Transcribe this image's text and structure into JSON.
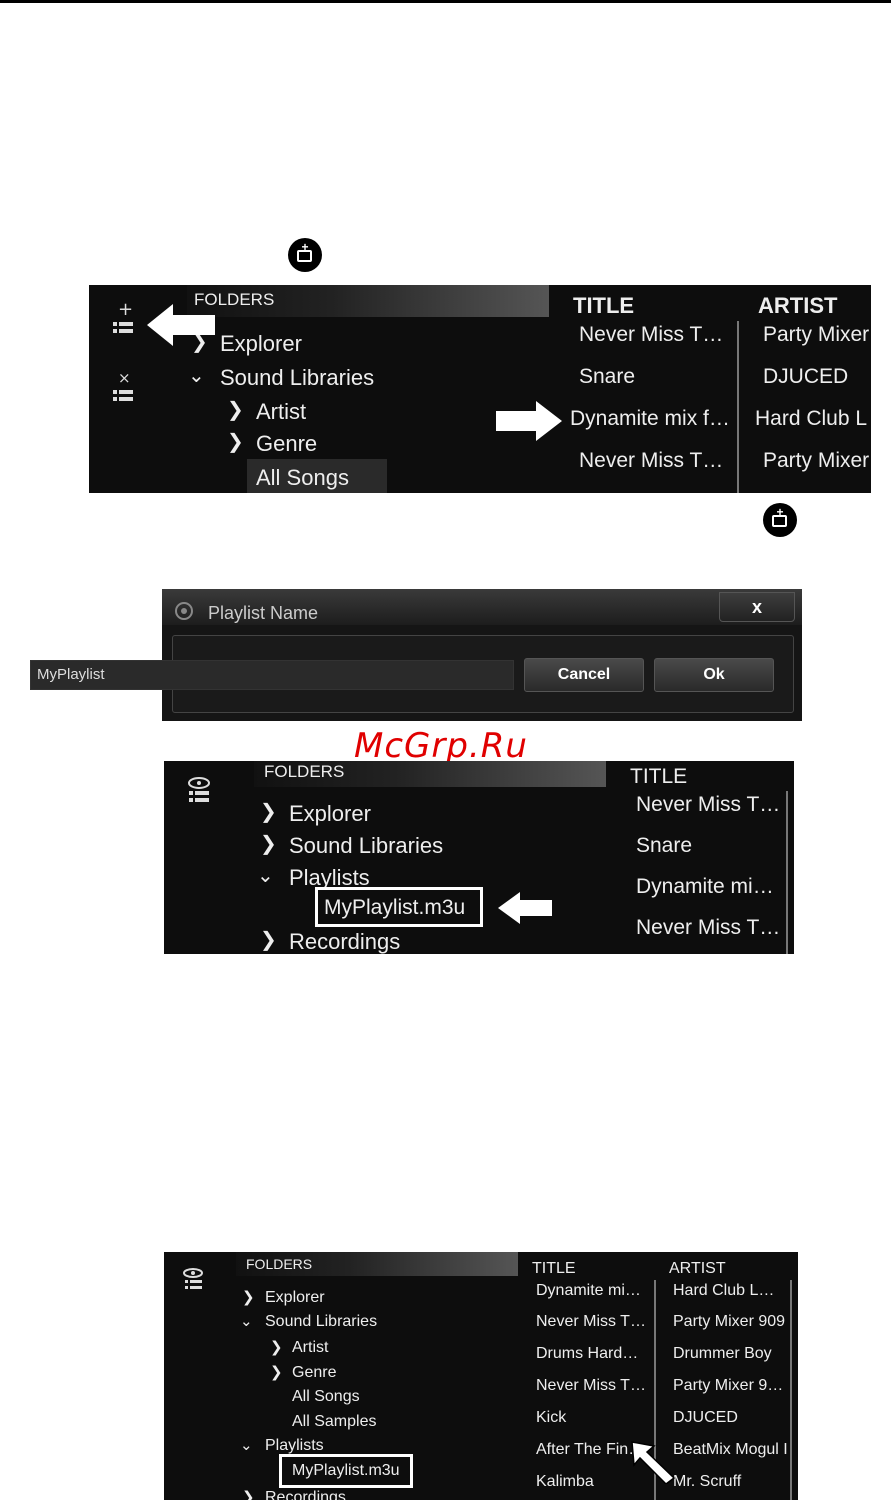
{
  "add_playlist_icon": "add-list-icon",
  "panel1": {
    "folders_header": "FOLDERS",
    "add_icon": "add-list-icon",
    "remove_icon": "remove-list-icon",
    "tree": {
      "explorer": "Explorer",
      "sound_libraries": "Sound Libraries",
      "artist": "Artist",
      "genre": "Genre",
      "all_songs": "All Songs"
    },
    "columns": {
      "title": "TITLE",
      "artist": "ARTIST"
    },
    "rows": [
      {
        "title": "Never Miss T…",
        "artist": "Party Mixer"
      },
      {
        "title": "Snare",
        "artist": "DJUCED"
      },
      {
        "title": "Dynamite mix f…",
        "artist": "Hard Club L"
      },
      {
        "title": "Never Miss T…",
        "artist": "Party Mixer"
      }
    ]
  },
  "dialog": {
    "title": "Playlist Name",
    "close": "x",
    "input_value": "MyPlaylist",
    "cancel": "Cancel",
    "ok": "Ok"
  },
  "watermark": "McGrp.Ru",
  "panel2": {
    "folders_header": "FOLDERS",
    "tree": {
      "explorer": "Explorer",
      "sound_libraries": "Sound Libraries",
      "playlists": "Playlists",
      "playlist_item": "MyPlaylist.m3u",
      "recordings": "Recordings"
    },
    "columns": {
      "title": "TITLE"
    },
    "rows": [
      "Never Miss T…",
      "Snare",
      "Dynamite mi…",
      "Never Miss T…"
    ]
  },
  "panel3": {
    "folders_header": "FOLDERS",
    "tree": {
      "explorer": "Explorer",
      "sound_libraries": "Sound Libraries",
      "artist": "Artist",
      "genre": "Genre",
      "all_songs": "All Songs",
      "all_samples": "All Samples",
      "playlists": "Playlists",
      "playlist_item": "MyPlaylist.m3u",
      "recordings": "Recordings"
    },
    "columns": {
      "title": "TITLE",
      "artist": "ARTIST"
    },
    "rows": [
      {
        "title": "Dynamite mi…",
        "artist": "Hard Club L…"
      },
      {
        "title": "Never Miss T…",
        "artist": "Party Mixer 909"
      },
      {
        "title": "Drums Hard…",
        "artist": "Drummer Boy"
      },
      {
        "title": "Never Miss T…",
        "artist": "Party Mixer 9…"
      },
      {
        "title": "Kick",
        "artist": "DJUCED"
      },
      {
        "title": "After The Fin…",
        "artist": "BeatMix Mogul I"
      },
      {
        "title": "Kalimba",
        "artist": "Mr. Scruff"
      }
    ]
  }
}
